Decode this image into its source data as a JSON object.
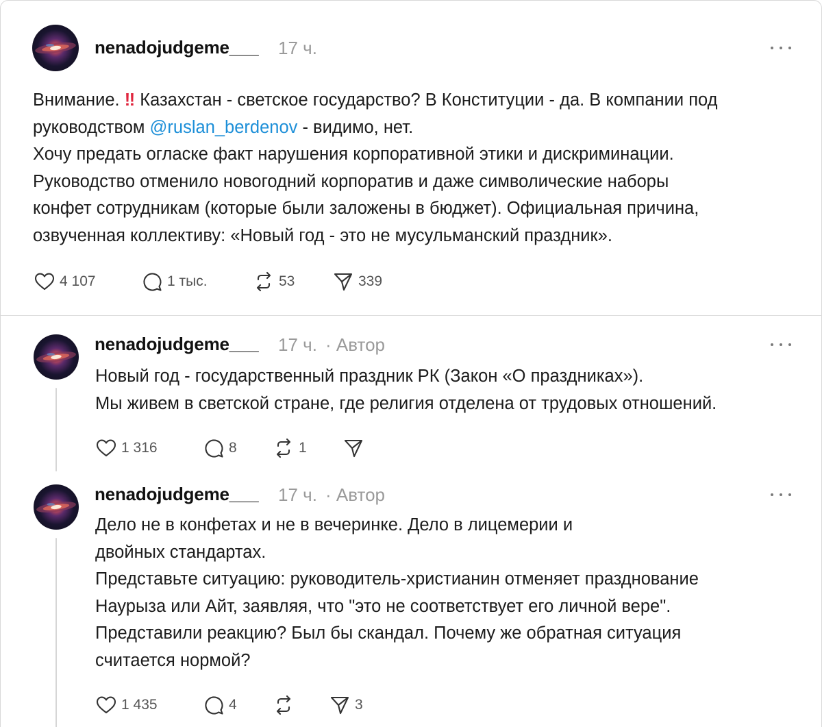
{
  "main_post": {
    "username": "nenadojudgeme___",
    "time": "17 ч.",
    "text_start": "Внимание. ",
    "emoji": "‼",
    "text_line1_rest": " Казахстан - светское государство? В Конституции - да. В компании под",
    "text_line2_before": "руководством ",
    "mention": "@ruslan_berdenov",
    "text_line2_after": " - видимо, нет.",
    "text_line3": "Хочу предать огласке факт нарушения корпоративной этики и дискриминации.",
    "text_line4": "Руководство отменило новогодний корпоратив и даже символические наборы",
    "text_line5": "конфет сотрудникам (которые были заложены в бюджет). Официальная причина,",
    "text_line6": "озвученная коллективу: «Новый год - это не мусульманский праздник».",
    "likes": "4 107",
    "comments": "1 тыс.",
    "reposts": "53",
    "shares": "339"
  },
  "replies": [
    {
      "username": "nenadojudgeme___",
      "time": "17 ч.",
      "author_label": "· Автор",
      "lines": [
        "Новый год - государственный праздник РК (Закон «О праздниках»).",
        "Мы живем в светской стране, где религия отделена от трудовых отношений."
      ],
      "likes": "1 316",
      "comments": "8",
      "reposts": "1",
      "shares": ""
    },
    {
      "username": "nenadojudgeme___",
      "time": "17 ч.",
      "author_label": "· Автор",
      "lines": [
        "Дело не в конфетах и не в вечеринке. Дело в лицемерии и",
        "двойных стандартах.",
        "Представьте ситуацию: руководитель-христианин отменяет празднование",
        "Наурыза или Айт, заявляя, что \"это не соответствует его личной вере\".",
        "Представили реакцию? Был бы скандал. Почему же обратная ситуация",
        "считается нормой?"
      ],
      "likes": "1 435",
      "comments": "4",
      "reposts": "",
      "shares": "3"
    }
  ],
  "icons": {
    "like": "heart-icon",
    "comment": "comment-bubble-icon",
    "repost": "repost-icon",
    "share": "send-icon",
    "more": "more-dots-icon"
  },
  "colors": {
    "mention": "#1d8fd8",
    "emoji": "#e0263e",
    "meta": "#9a9a9a",
    "divider": "#dcdcdc"
  }
}
